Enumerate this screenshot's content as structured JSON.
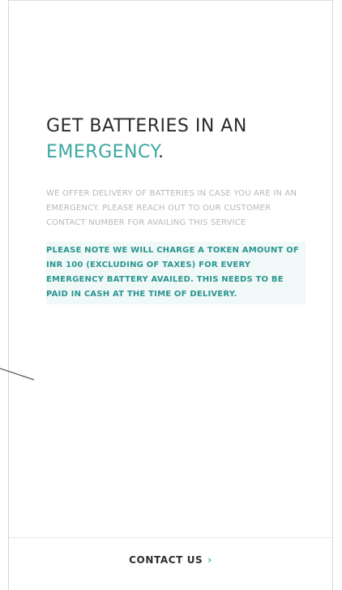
{
  "modal": {
    "title_line1": "GET BATTERIES IN AN",
    "title_accent": "EMERGENCY",
    "title_dot": ".",
    "paragraph": "WE OFFER DELIVERY OF BATTERIES IN CASE YOU ARE IN AN EMERGENCY. PLEASE REACH OUT TO OUR CUSTOMER CONTACT NUMBER FOR AVAILING THIS SERVICE",
    "note": "PLEASE NOTE WE WILL CHARGE A TOKEN AMOUNT OF INR 100 (EXCLUDING OF TAXES) FOR EVERY EMERGENCY BATTERY AVAILED. THIS NEEDS TO BE PAID IN CASH AT THE TIME OF DELIVERY."
  },
  "footer": {
    "contact_label": "CONTACT US",
    "chevron_icon": "chevron-right-icon"
  },
  "colors": {
    "accent": "#3aa7a1",
    "title": "#2b2b2b",
    "muted": "#b8b8b8"
  }
}
